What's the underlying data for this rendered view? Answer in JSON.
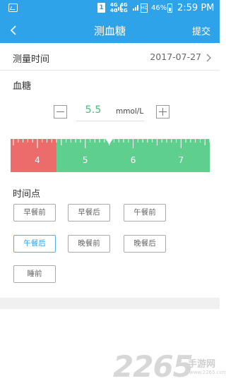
{
  "status_bar": {
    "sim_label": "1",
    "network_1": "4G",
    "network_1b": "4G",
    "network_2": "2G",
    "hd_label": "HD",
    "battery": "46%",
    "time": "2:59 PM"
  },
  "nav": {
    "title": "测血糖",
    "submit": "提交"
  },
  "measure_time": {
    "label": "测量时间",
    "value": "2017-07-27"
  },
  "blood_sugar": {
    "label": "血糖",
    "value": "5.5",
    "unit": "mmol/L"
  },
  "ruler": {
    "ticks": [
      "4",
      "5",
      "6",
      "7"
    ],
    "low_color": "#ec6b6b",
    "normal_color": "#5ecf8c",
    "red_end": 4.4,
    "min": 3.44,
    "max": 7.6,
    "current": 5.5
  },
  "time_point": {
    "label": "时间点",
    "options": [
      "早餐前",
      "早餐后",
      "午餐前",
      "午餐后",
      "晚餐前",
      "晚餐后",
      "睡前"
    ],
    "selected": "午餐后"
  },
  "watermark": {
    "number": "2265",
    "text": "手游网",
    "url": "www.2265.com"
  },
  "colors": {
    "primary": "#2fa3ea",
    "accent_green": "#4cbf7f"
  }
}
